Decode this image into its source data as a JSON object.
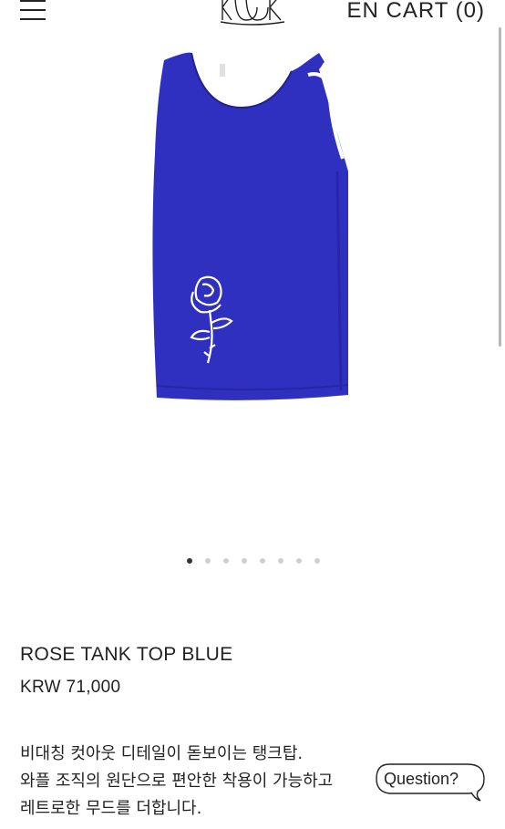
{
  "header": {
    "menu_icon": "hamburger-menu-icon",
    "logo_icon": "brand-logo",
    "lang_label": "EN",
    "cart_label": "CART (0)"
  },
  "product": {
    "image_icon": "blue-tank-top-rose-print",
    "name": "ROSE TANK TOP BLUE",
    "price": "KRW 71,000",
    "description": [
      "비대칭 컷아웃 디테일이 돋보이는 탱크탑.",
      "와플 조직의 원단으로 편안한 착용이 가능하고",
      "레트로한 무드를 더합니다."
    ],
    "color": "#3030c0"
  },
  "gallery": {
    "dot_count": 8,
    "active_index": 0
  },
  "question_button": {
    "label": "Question?"
  }
}
